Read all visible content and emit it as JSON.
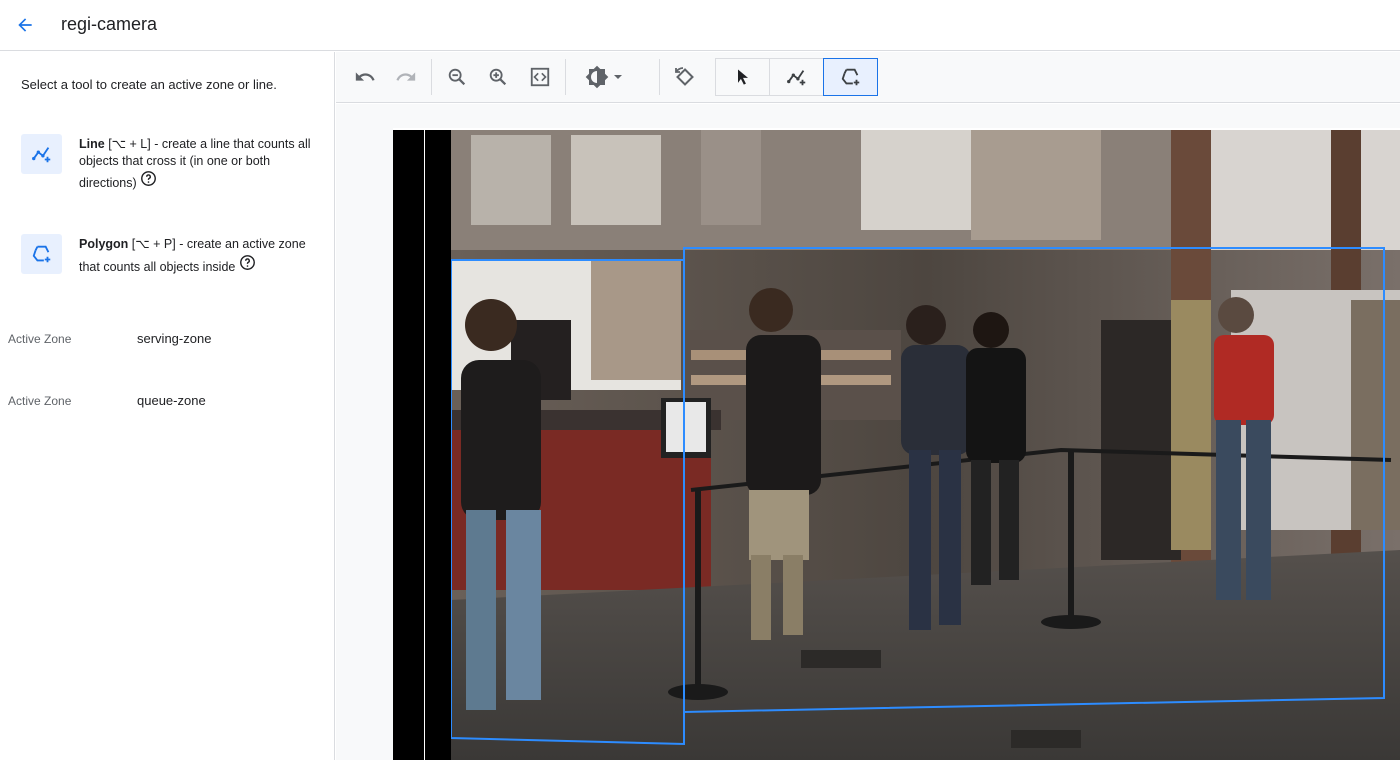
{
  "header": {
    "title": "regi-camera"
  },
  "left_panel": {
    "instruction": "Select a tool to create an active zone or line.",
    "tools": [
      {
        "name": "Line",
        "shortcut": "[⌥ + L]",
        "description": " - create a line that counts all objects that cross it (in one or both directions)"
      },
      {
        "name": "Polygon",
        "shortcut": "[⌥ + P]",
        "description": " - create an active zone that counts all objects inside"
      }
    ],
    "zones": [
      {
        "type": "Active Zone",
        "name": "serving-zone"
      },
      {
        "type": "Active Zone",
        "name": "queue-zone"
      }
    ]
  },
  "toolbar": {
    "buttons": [
      "undo-icon",
      "redo-icon",
      "zoom-out-icon",
      "zoom-in-icon",
      "fit-screen-icon",
      "brightness-icon",
      "reset-rotation-icon"
    ],
    "modes": [
      "select-pointer-icon",
      "line-tool-icon",
      "polygon-tool-icon"
    ],
    "active_mode": "polygon-tool-icon"
  },
  "colors": {
    "accent": "#1a73e8",
    "zone_outline": "#2d8cff",
    "icon": "#5f6368",
    "active_bg": "#e8f0fe"
  }
}
